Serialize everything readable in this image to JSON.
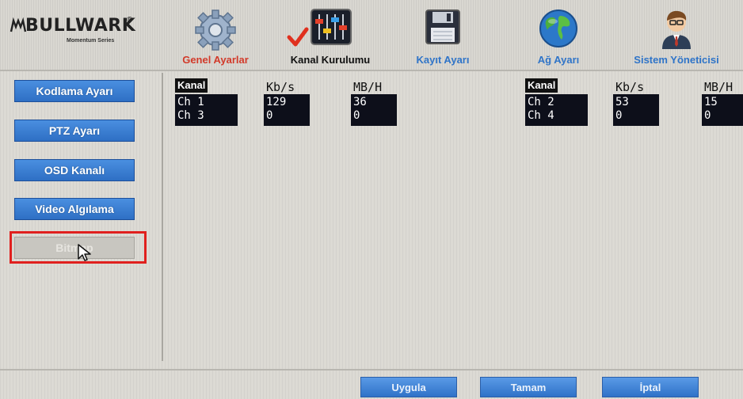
{
  "brand": {
    "name": "BULLWARK",
    "trademark": "®",
    "subtitle": "Momentum Series"
  },
  "tabs": [
    {
      "label": "Genel Ayarlar",
      "icon": "gear-icon"
    },
    {
      "label": "Kanal Kurulumu",
      "icon": "mixer-sliders-icon"
    },
    {
      "label": "Kayıt Ayarı",
      "icon": "floppy-disk-icon"
    },
    {
      "label": "Ağ Ayarı",
      "icon": "globe-icon"
    },
    {
      "label": "Sistem Yöneticisi",
      "icon": "user-icon"
    }
  ],
  "sidebar": {
    "items": [
      {
        "label": "Kodlama Ayarı"
      },
      {
        "label": "PTZ Ayarı"
      },
      {
        "label": "OSD Kanalı"
      },
      {
        "label": "Video Algılama"
      },
      {
        "label": "Bitmap"
      }
    ]
  },
  "stats": {
    "headers": {
      "channel": "Kanal",
      "kbs": "Kb/s",
      "mbh": "MB/H"
    },
    "left": [
      {
        "channel": "Ch 1",
        "kbs": "129",
        "mbh": "36"
      },
      {
        "channel": "Ch 3",
        "kbs": "0",
        "mbh": "0"
      }
    ],
    "right": [
      {
        "channel": "Ch 2",
        "kbs": "53",
        "mbh": "15"
      },
      {
        "channel": "Ch 4",
        "kbs": "0",
        "mbh": "0"
      }
    ]
  },
  "actions": {
    "apply": "Uygula",
    "ok": "Tamam",
    "cancel": "İptal"
  },
  "colors": {
    "accent_blue": "#2f72c8",
    "active_tab_red": "#d23a2a",
    "highlight_red": "#e0201e",
    "check_red": "#e0301e"
  }
}
